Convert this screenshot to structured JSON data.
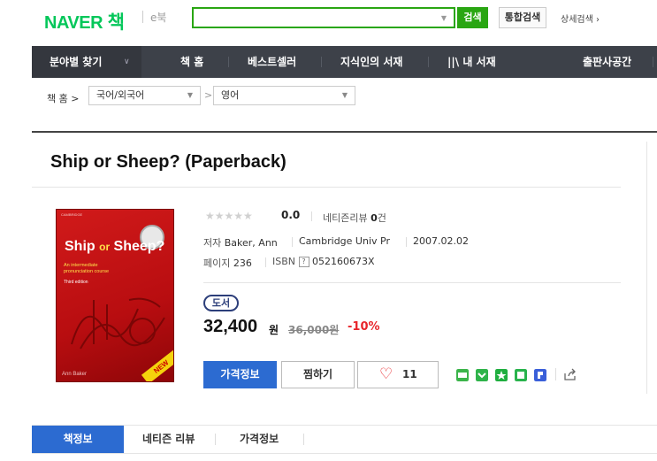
{
  "header": {
    "logo_naver": "NAVER",
    "logo_book": "책",
    "ebook": "e북",
    "search_value": "",
    "search_button": "검색",
    "total_search_button": "통합검색",
    "detail_search": "상세검색 ›"
  },
  "gnb": {
    "items": [
      "분야별 찾기",
      "책 홈",
      "베스트셀러",
      "지식인의 서재",
      "내 서재",
      "출판사공간"
    ]
  },
  "breadcrumb": {
    "home": "책 홈 >",
    "category1": "국어/외국어",
    "sep": ">",
    "category2": "영어"
  },
  "book": {
    "title": "Ship or Sheep? (Paperback)",
    "cover": {
      "publisher": "CAMBRIDGE",
      "title_1": "Ship ",
      "title_or": "or",
      "title_2": " Sheep?",
      "subtitle_1": "An intermediate",
      "subtitle_2": "pronunciation course",
      "edition": "Third edition",
      "author": "Ann Baker",
      "new_label": "NEW"
    },
    "stars": "★★★★★",
    "rating": "0.0",
    "review_label": "네티즌리뷰 ",
    "review_count": "0",
    "review_unit": "건",
    "author_label": "저자 ",
    "author": "Baker, Ann",
    "publisher": "Cambridge Univ Pr",
    "date": "2007.02.02",
    "pages_label": "페이지 ",
    "pages": "236",
    "isbn_label": "ISBN ",
    "isbn_help": "?",
    "isbn": "052160673X",
    "badge": "도서",
    "price": "32,400",
    "price_unit": "원",
    "orig_price": "36,000원",
    "discount": "-10%"
  },
  "actions": {
    "price_info": "가격정보",
    "wish": "찜하기",
    "like_count": "11"
  },
  "share_icons": [
    "blog-icon",
    "talk-icon",
    "star-icon",
    "square-icon",
    "pay-icon",
    "share-icon"
  ],
  "colors": {
    "brand": "#03c75a",
    "search_green": "#29a612",
    "primary_blue": "#2c6bd1",
    "discount_red": "#e8252b",
    "gnb_bg": "#3d4149"
  },
  "tabs": [
    "책정보",
    "네티즌 리뷰",
    "가격정보"
  ]
}
